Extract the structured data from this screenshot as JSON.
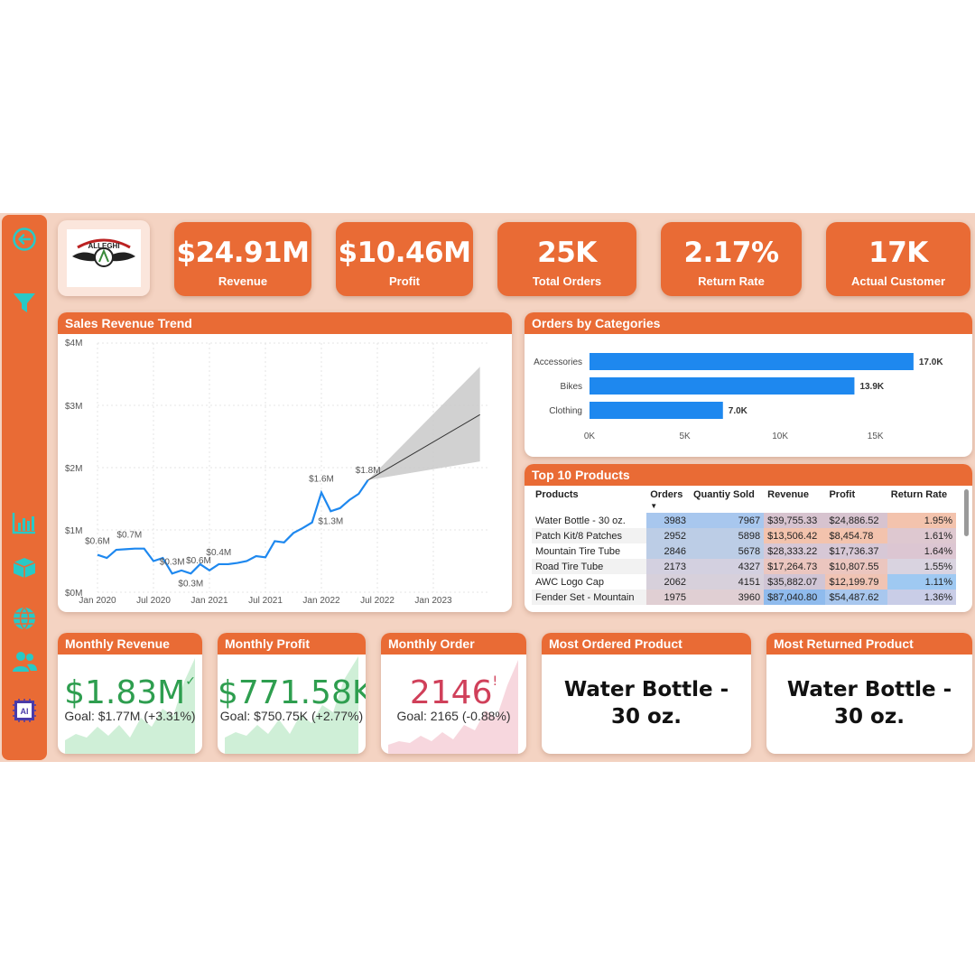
{
  "kpis": [
    {
      "value": "$24.91M",
      "label": "Revenue"
    },
    {
      "value": "$10.46M",
      "label": "Profit"
    },
    {
      "value": "25K",
      "label": "Total Orders"
    },
    {
      "value": "2.17%",
      "label": "Return Rate"
    },
    {
      "value": "17K",
      "label": "Actual Customer"
    }
  ],
  "logo": {
    "text": "ALLEGHI"
  },
  "nav": {
    "icons": [
      "back-arrow-icon",
      "filter-icon",
      "bar-chart-icon",
      "box-icon",
      "globe-icon",
      "users-icon",
      "ai-chip-icon"
    ]
  },
  "colors": {
    "accent": "#e96b35",
    "background": "#f4d3c2",
    "bar": "#1e88ef",
    "line": "#1e88ef",
    "good": "#2e9e4f",
    "bad": "#d0405a"
  },
  "sales_trend": {
    "title": "Sales Revenue Trend",
    "y_ticks": [
      "$4M",
      "$3M",
      "$2M",
      "$1M",
      "$0M"
    ],
    "x_ticks": [
      "Jan 2020",
      "Jul 2020",
      "Jan 2021",
      "Jul 2021",
      "Jan 2022",
      "Jul 2022",
      "Jan 2023"
    ],
    "data_labels": [
      "$0.6M",
      "$0.7M",
      "$0.3M",
      "$0.3M",
      "$0.4M",
      "$0.6M",
      "$1.6M",
      "$1.3M",
      "$1.8M"
    ]
  },
  "categories_panel": {
    "title": "Orders by Categories",
    "x_ticks": [
      "0K",
      "5K",
      "10K",
      "15K"
    ]
  },
  "chart_data": [
    {
      "type": "line",
      "title": "Sales Revenue Trend",
      "xlabel": "",
      "ylabel": "",
      "ylim": [
        0,
        4
      ],
      "unit": "$M",
      "x": [
        "2020-01",
        "2020-02",
        "2020-03",
        "2020-04",
        "2020-05",
        "2020-06",
        "2020-07",
        "2020-08",
        "2020-09",
        "2020-10",
        "2020-11",
        "2020-12",
        "2021-01",
        "2021-02",
        "2021-03",
        "2021-04",
        "2021-05",
        "2021-06",
        "2021-07",
        "2021-08",
        "2021-09",
        "2021-10",
        "2021-11",
        "2021-12",
        "2022-01",
        "2022-02",
        "2022-03",
        "2022-04",
        "2022-05",
        "2022-06"
      ],
      "values": [
        0.6,
        0.55,
        0.68,
        0.69,
        0.7,
        0.7,
        0.5,
        0.55,
        0.3,
        0.35,
        0.3,
        0.45,
        0.35,
        0.45,
        0.45,
        0.47,
        0.5,
        0.58,
        0.56,
        0.82,
        0.8,
        0.95,
        1.03,
        1.12,
        1.6,
        1.3,
        1.35,
        1.48,
        1.58,
        1.8
      ],
      "forecast": {
        "x": [
          "2022-06",
          "2023-06"
        ],
        "values": [
          1.8,
          2.85
        ],
        "upper": [
          1.8,
          3.62
        ],
        "lower": [
          1.8,
          2.1
        ]
      }
    },
    {
      "type": "bar",
      "orientation": "horizontal",
      "title": "Orders by Categories",
      "categories": [
        "Accessories",
        "Bikes",
        "Clothing"
      ],
      "values": [
        17.0,
        13.9,
        7.0
      ],
      "labels": [
        "17.0K",
        "13.9K",
        "7.0K"
      ],
      "xlim": [
        0,
        18
      ],
      "x_ticks": [
        "0K",
        "5K",
        "10K",
        "15K"
      ]
    }
  ],
  "top10": {
    "title": "Top 10 Products",
    "columns": [
      "Products",
      "Orders",
      "Quantiy Sold",
      "Revenue",
      "Profit",
      "Return Rate"
    ],
    "rows": [
      [
        "Water Bottle - 30 oz.",
        "3983",
        "7967",
        "$39,755.33",
        "$24,886.52",
        "1.95%"
      ],
      [
        "Patch Kit/8 Patches",
        "2952",
        "5898",
        "$13,506.42",
        "$8,454.78",
        "1.61%"
      ],
      [
        "Mountain Tire Tube",
        "2846",
        "5678",
        "$28,333.22",
        "$17,736.37",
        "1.64%"
      ],
      [
        "Road Tire Tube",
        "2173",
        "4327",
        "$17,264.73",
        "$10,807.55",
        "1.55%"
      ],
      [
        "AWC Logo Cap",
        "2062",
        "4151",
        "$35,882.07",
        "$12,199.79",
        "1.11%"
      ],
      [
        "Fender Set - Mountain",
        "1975",
        "3960",
        "$87,040.80",
        "$54,487.62",
        "1.36%"
      ]
    ],
    "cell_colors": [
      [
        "",
        "#a8c7ee",
        "#a8c7ee",
        "#d7c3cf",
        "#d7c3cf",
        "#f3c3ad"
      ],
      [
        "",
        "#bccde6",
        "#bccde6",
        "#f3c3ad",
        "#f3c3ad",
        "#dec8d0"
      ],
      [
        "",
        "#bccde6",
        "#bccde6",
        "#d7c8d6",
        "#d7c8d6",
        "#dcc6d2"
      ],
      [
        "",
        "#d3d0e0",
        "#d3d0e0",
        "#ebc6bf",
        "#ebc6bf",
        "#d9d3e0"
      ],
      [
        "",
        "#d7d0db",
        "#d7d0db",
        "#d0c5d5",
        "#f0c4b4",
        "#9fc9f2"
      ],
      [
        "",
        "#e0cfd3",
        "#e0cfd3",
        "#8fbbed",
        "#a8c7ee",
        "#c9cde7"
      ]
    ]
  },
  "monthly_revenue": {
    "title": "Monthly Revenue",
    "value": "$1.83M",
    "goal": "Goal: $1.77M (+3.31%)",
    "status": "✓",
    "progress": 1.0331
  },
  "monthly_profit": {
    "title": "Monthly Profit",
    "value": "$771.58K",
    "goal": "Goal: $750.75K (+2.77%)",
    "status": "✓",
    "progress": 1.0277
  },
  "monthly_order": {
    "title": "Monthly Order",
    "value": "2146",
    "goal": "Goal: 2165 (-0.88%)",
    "status": "!",
    "progress": 0.9912
  },
  "most_ordered": {
    "title": "Most Ordered Product",
    "value": "Water Bottle - 30 oz."
  },
  "most_returned": {
    "title": "Most Returned Product",
    "value": "Water Bottle - 30 oz."
  }
}
